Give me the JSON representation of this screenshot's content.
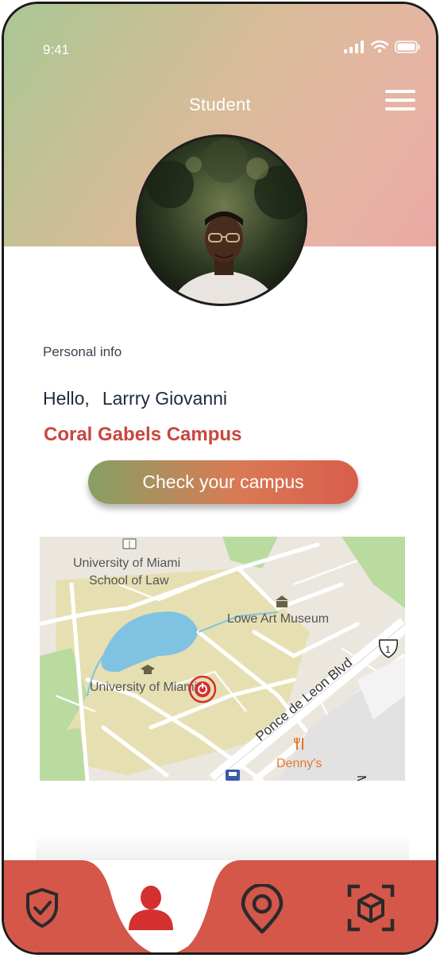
{
  "status_bar": {
    "time": "9:41"
  },
  "header": {
    "title": "Student"
  },
  "profile": {
    "section_label": "Personal info",
    "greeting": "Hello,",
    "name": "Larrry Giovanni",
    "campus": "Coral Gabels Campus",
    "cta_label": "Check your campus"
  },
  "map": {
    "labels": {
      "law_school_line1": "University of Miami",
      "law_school_line2": "School of Law",
      "museum": "Lowe Art Museum",
      "university": "University of Miami",
      "road": "Ponce de Leon Blvd",
      "restaurant": "Denny's",
      "route": "1",
      "edge_text": "M"
    }
  },
  "tabbar": {
    "tabs": [
      "security",
      "profile",
      "location",
      "scan"
    ],
    "active": "profile"
  },
  "colors": {
    "accent": "#d4574a",
    "campus_text": "#c8463f",
    "active_icon": "#d3302f"
  }
}
